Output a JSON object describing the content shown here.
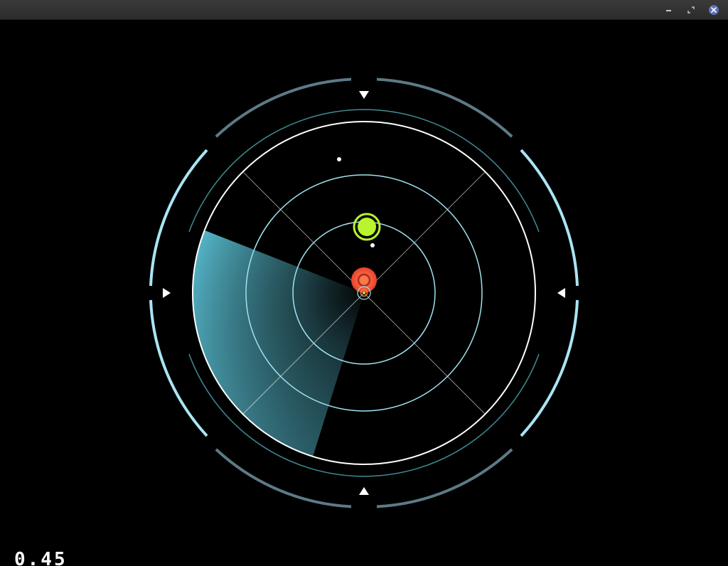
{
  "hud": {
    "timer": "0.45"
  },
  "colors": {
    "titlebar": "#2f2f2f",
    "frame": "#5d7a86",
    "frame_bright": "#a9e5f4",
    "teal_ring": "#3e8e96",
    "white_ring": "#ffffff",
    "inner_rings": "#9fe4f0",
    "sweep": "#5bc4d8",
    "player": "#b8f52e",
    "enemy": "#ff5a3a",
    "close_button": "#5a6fb4"
  },
  "icons": {
    "minimize": "minimize-icon",
    "maximize": "maximize-icon",
    "close": "close-icon",
    "direction_markers": [
      "arrow-down-icon",
      "arrow-left-icon",
      "arrow-up-icon",
      "arrow-right-icon"
    ]
  },
  "game": {
    "player_count": 1,
    "enemy_count": 1,
    "dot_count": 2
  }
}
